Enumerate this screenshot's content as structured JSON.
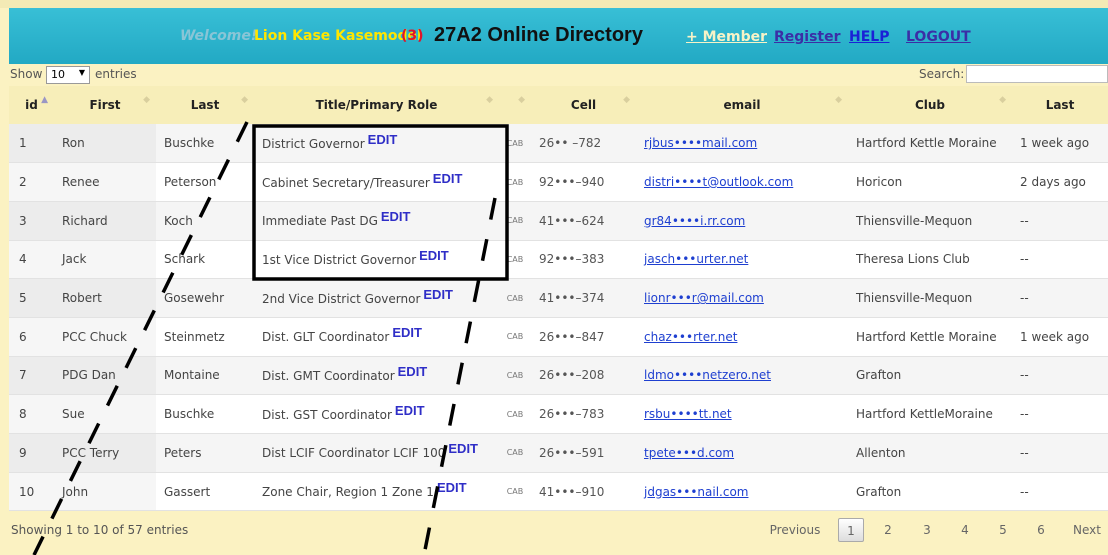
{
  "header": {
    "welcome": "Welcome!",
    "username": "Lion Kase Kasemodel",
    "count": "(3)",
    "title": "27A2 Online Directory",
    "nav": {
      "member": "+ Member",
      "register": "Register",
      "help": "HELP",
      "logout": "LOGOUT"
    }
  },
  "controls": {
    "show_label": "Show",
    "length_value": "10",
    "entries_label": "entries",
    "search_label": "Search:",
    "search_value": ""
  },
  "table": {
    "columns": [
      "id",
      "First",
      "Last",
      "Title/Primary Role",
      "",
      "Cell",
      "email",
      "Club",
      "Last"
    ],
    "edit_label": "EDIT",
    "cab_label": "CAB",
    "rows": [
      {
        "id": "1",
        "first": "Ron",
        "last": "Buschke",
        "role": "District Governor",
        "cell": "26•• –782",
        "email": "rjbus••••mail.com",
        "club": "Hartford Kettle Moraine",
        "last_seen": "1 week ago"
      },
      {
        "id": "2",
        "first": "Renee",
        "last": "Peterson",
        "role": "Cabinet Secretary/Treasurer",
        "cell": "92•••–940",
        "email": "distri••••t@outlook.com",
        "club": "Horicon",
        "last_seen": "2 days ago"
      },
      {
        "id": "3",
        "first": "Richard",
        "last": "Koch",
        "role": "Immediate Past DG",
        "cell": "41•••–624",
        "email": "gr84••••i.rr.com",
        "club": "Thiensville-Mequon",
        "last_seen": "--"
      },
      {
        "id": "4",
        "first": "Jack",
        "last": "Schark",
        "role": "1st Vice District Governor",
        "cell": "92•••–383",
        "email": "jasch•••urter.net",
        "club": "Theresa Lions Club",
        "last_seen": "--"
      },
      {
        "id": "5",
        "first": "Robert",
        "last": "Gosewehr",
        "role": "2nd Vice District Governor",
        "cell": "41•••–374",
        "email": "lionr•••r@mail.com",
        "club": "Thiensville-Mequon",
        "last_seen": "--"
      },
      {
        "id": "6",
        "first": "PCC Chuck",
        "last": "Steinmetz",
        "role": "Dist. GLT Coordinator",
        "cell": "26•••–847",
        "email": "chaz•••rter.net",
        "club": "Hartford Kettle Moraine",
        "last_seen": "1 week ago"
      },
      {
        "id": "7",
        "first": "PDG Dan",
        "last": "Montaine",
        "role": "Dist. GMT Coordinator",
        "cell": "26•••–208",
        "email": "ldmo••••netzero.net",
        "club": "Grafton",
        "last_seen": "--"
      },
      {
        "id": "8",
        "first": "Sue",
        "last": "Buschke",
        "role": "Dist. GST Coordinator",
        "cell": "26•••–783",
        "email": "rsbu••••tt.net",
        "club": "Hartford KettleMoraine",
        "last_seen": "--"
      },
      {
        "id": "9",
        "first": "PCC Terry",
        "last": "Peters",
        "role": "Dist LCIF Coordinator LCIF 100",
        "cell": "26•••–591",
        "email": "tpete•••d.com",
        "club": "Allenton",
        "last_seen": "--"
      },
      {
        "id": "10",
        "first": "John",
        "last": "Gassert",
        "role": "Zone Chair, Region 1 Zone 1",
        "cell": "41•••–910",
        "email": "jdgas•••nail.com",
        "club": "Grafton",
        "last_seen": "--"
      }
    ]
  },
  "footer": {
    "info": "Showing 1 to 10 of 57 entries",
    "previous": "Previous",
    "pages": [
      "1",
      "2",
      "3",
      "4",
      "5",
      "6"
    ],
    "current_page": "1",
    "next": "Next"
  },
  "colors": {
    "header_bg": "#22a9c4",
    "page_bg": "#fbf2c2",
    "username": "#ffe600",
    "edit": "#2f2ec7",
    "link": "#1e3fd0"
  }
}
